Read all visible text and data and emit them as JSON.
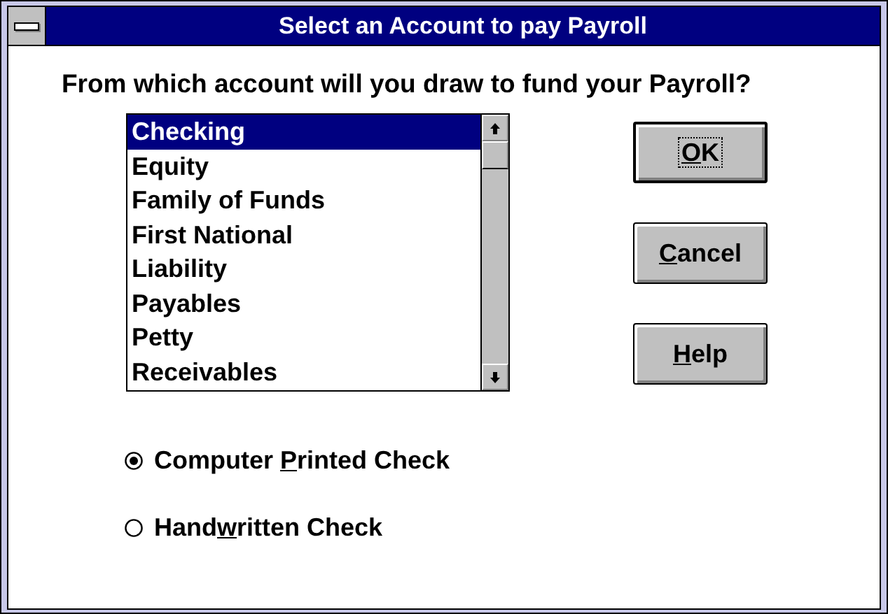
{
  "window": {
    "title": "Select an Account to pay Payroll"
  },
  "prompt": "From which account will you draw to fund your Payroll?",
  "accounts": [
    {
      "label": "Checking",
      "selected": true
    },
    {
      "label": "Equity",
      "selected": false
    },
    {
      "label": "Family of Funds",
      "selected": false
    },
    {
      "label": "First National",
      "selected": false
    },
    {
      "label": "Liability",
      "selected": false
    },
    {
      "label": "Payables",
      "selected": false
    },
    {
      "label": "Petty",
      "selected": false
    },
    {
      "label": "Receivables",
      "selected": false
    }
  ],
  "buttons": [
    {
      "mnemonic": "O",
      "after": "K",
      "default": true
    },
    {
      "mnemonic": "C",
      "after": "ancel",
      "default": false
    },
    {
      "mnemonic": "H",
      "after": "elp",
      "default": false
    }
  ],
  "check_type": [
    {
      "before": "Computer ",
      "mnemonic": "P",
      "after": "rinted Check",
      "selected": true
    },
    {
      "before": "Hand",
      "mnemonic": "w",
      "after": "ritten Check",
      "selected": false
    }
  ]
}
